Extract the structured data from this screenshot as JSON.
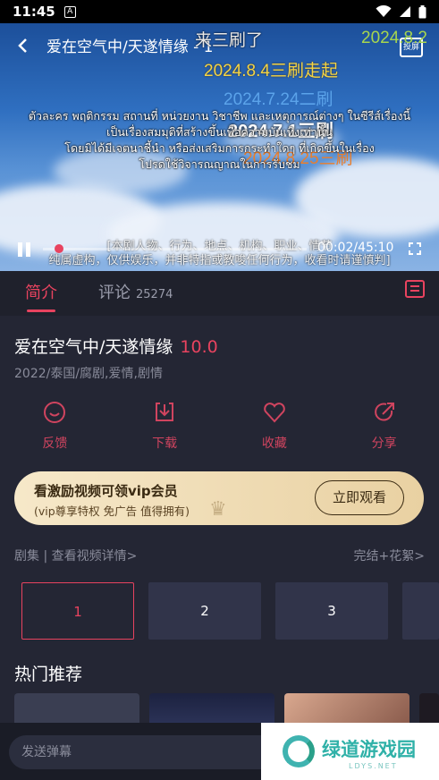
{
  "status_bar": {
    "time": "11:45",
    "notification_glyph": "A",
    "icons": [
      "wifi-icon",
      "signal-icon",
      "battery-icon"
    ]
  },
  "player": {
    "title": "爱在空气中/天遂情缘 - 1",
    "cast_label": "投屏",
    "danmaku": [
      {
        "text": "来三刷了",
        "color": "#e9e9e9"
      },
      {
        "text": "2024.8.2",
        "color": "#a7d64e"
      },
      {
        "text": "2024.8.4三刷走起",
        "color": "#f4d444"
      },
      {
        "text": "2024.7.24二刷",
        "color": "#5ba3ea"
      },
      {
        "text": "2024.7.1三刷",
        "color": "#ffffff"
      },
      {
        "text": "2024.8.25三刷",
        "color": "#ea7e2c"
      }
    ],
    "thai_subtitle": [
      "ตัวละคร พฤติกรรม สถานที่ หน่วยงาน วิชาชีพ และเหตุการณ์ต่างๆ ในซีรีส์เรื่องนี้",
      "เป็นเรื่องสมมุติที่สร้างขึ้นเพื่อความบันเทิงเท่านั้น",
      "โดยมิได้มีเจตนาชี้นำ หรือส่งเสริมการกระทำใดๆ ที่เกิดขึ้นในเรื่อง",
      "โปรดใช้วิจารณญาณในการรับชม"
    ],
    "chinese_subtitle": [
      "[本剧人物、行为、地点、机构、职业、情节",
      "纯属虚构，仅供娱乐，并非特指或教唆任何行为，收看时请谨慎判]"
    ],
    "timecode": "00:02/45:10",
    "progress": 0.044
  },
  "tabs": {
    "intro": "简介",
    "comments": "评论",
    "comments_count": "25274"
  },
  "show": {
    "title": "爱在空气中/天遂情缘",
    "score": "10.0",
    "meta": "2022/泰国/腐剧,爱情,剧情"
  },
  "actions": [
    {
      "label": "反馈",
      "icon": "feedback-icon"
    },
    {
      "label": "下载",
      "icon": "download-icon"
    },
    {
      "label": "收藏",
      "icon": "heart-icon"
    },
    {
      "label": "分享",
      "icon": "share-icon"
    }
  ],
  "vip_banner": {
    "title": "看激励视频可领vip会员",
    "subtitle": "(vip尊享特权 免广告 值得拥有)",
    "button": "立即观看"
  },
  "episodes": {
    "header_left": "剧集 | 查看视频详情>",
    "header_right": "完结+花絮>",
    "items": [
      "1",
      "2",
      "3"
    ]
  },
  "hot": {
    "title": "热门推荐"
  },
  "bottom": {
    "danmaku_placeholder": "发送弹幕",
    "watermark_name": "绿道游戏园",
    "watermark_url": "LDYS.NET"
  },
  "colors": {
    "accent": "#e8435f",
    "background": "#242634",
    "vip_gold": "#ecd6a8"
  }
}
